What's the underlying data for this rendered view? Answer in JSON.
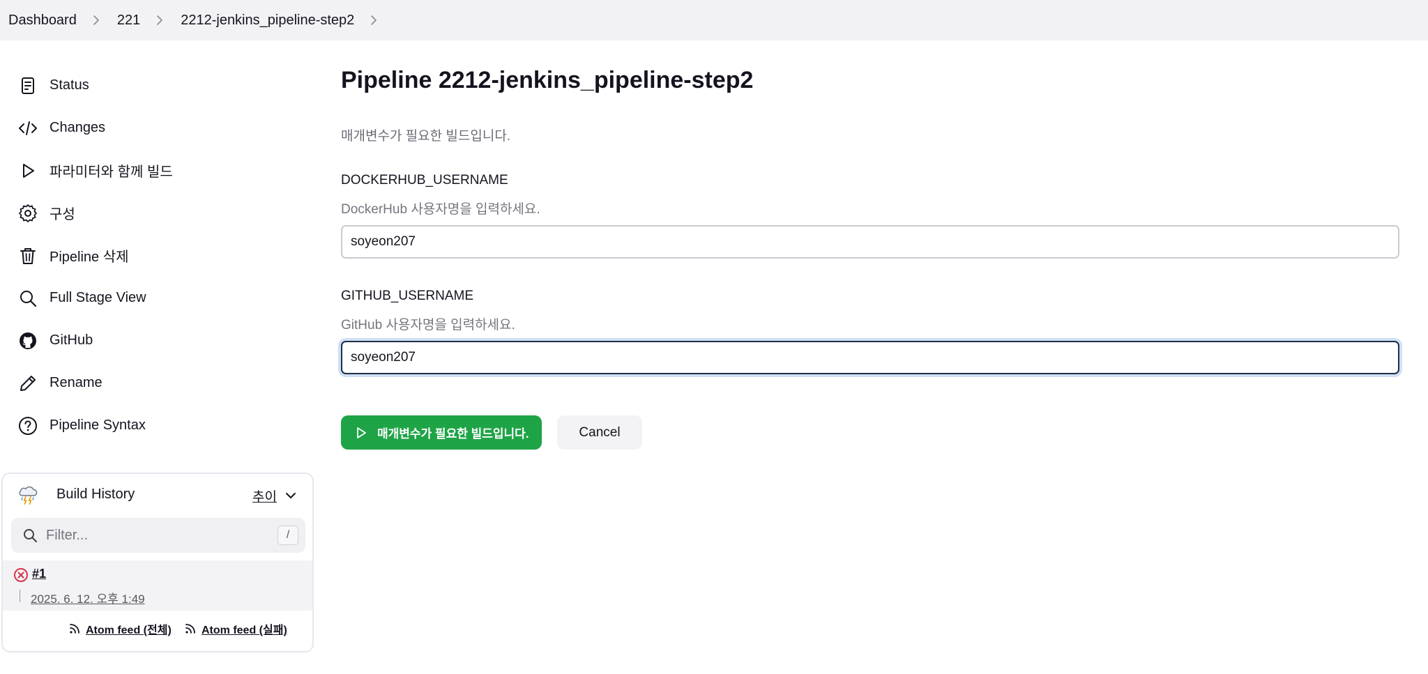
{
  "breadcrumb": {
    "items": [
      "Dashboard",
      "221",
      "2212-jenkins_pipeline-step2"
    ]
  },
  "sidebar": {
    "items": [
      {
        "label": "Status",
        "icon": "document-icon"
      },
      {
        "label": "Changes",
        "icon": "code-icon"
      },
      {
        "label": "파라미터와 함께 빌드",
        "icon": "play-icon"
      },
      {
        "label": "구성",
        "icon": "gear-icon"
      },
      {
        "label": "Pipeline 삭제",
        "icon": "trash-icon"
      },
      {
        "label": "Full Stage View",
        "icon": "search-icon"
      },
      {
        "label": "GitHub",
        "icon": "github-icon"
      },
      {
        "label": "Rename",
        "icon": "pencil-icon"
      },
      {
        "label": "Pipeline Syntax",
        "icon": "help-icon"
      }
    ]
  },
  "build_history": {
    "title": "Build History",
    "trend_label": "추이",
    "filter_placeholder": "Filter...",
    "filter_shortcut": "/",
    "builds": [
      {
        "number": "#1",
        "date": "2025. 6. 12. 오후 1:49",
        "status": "failed"
      }
    ],
    "feeds": [
      "Atom feed (전체)",
      "Atom feed (실패)"
    ]
  },
  "main": {
    "title": "Pipeline 2212-jenkins_pipeline-step2",
    "description": "매개변수가 필요한 빌드입니다.",
    "params": [
      {
        "name": "DOCKERHUB_USERNAME",
        "description": "DockerHub 사용자명을 입력하세요.",
        "value": "soyeon207"
      },
      {
        "name": "GITHUB_USERNAME",
        "description": "GitHub  사용자명을 입력하세요.",
        "value": "soyeon207"
      }
    ],
    "build_button": "매개변수가 필요한 빌드입니다.",
    "cancel_button": "Cancel"
  },
  "colors": {
    "build_button": "#1ea446",
    "fail_status": "#d6334a",
    "focus_ring": "#cfe0f5"
  }
}
